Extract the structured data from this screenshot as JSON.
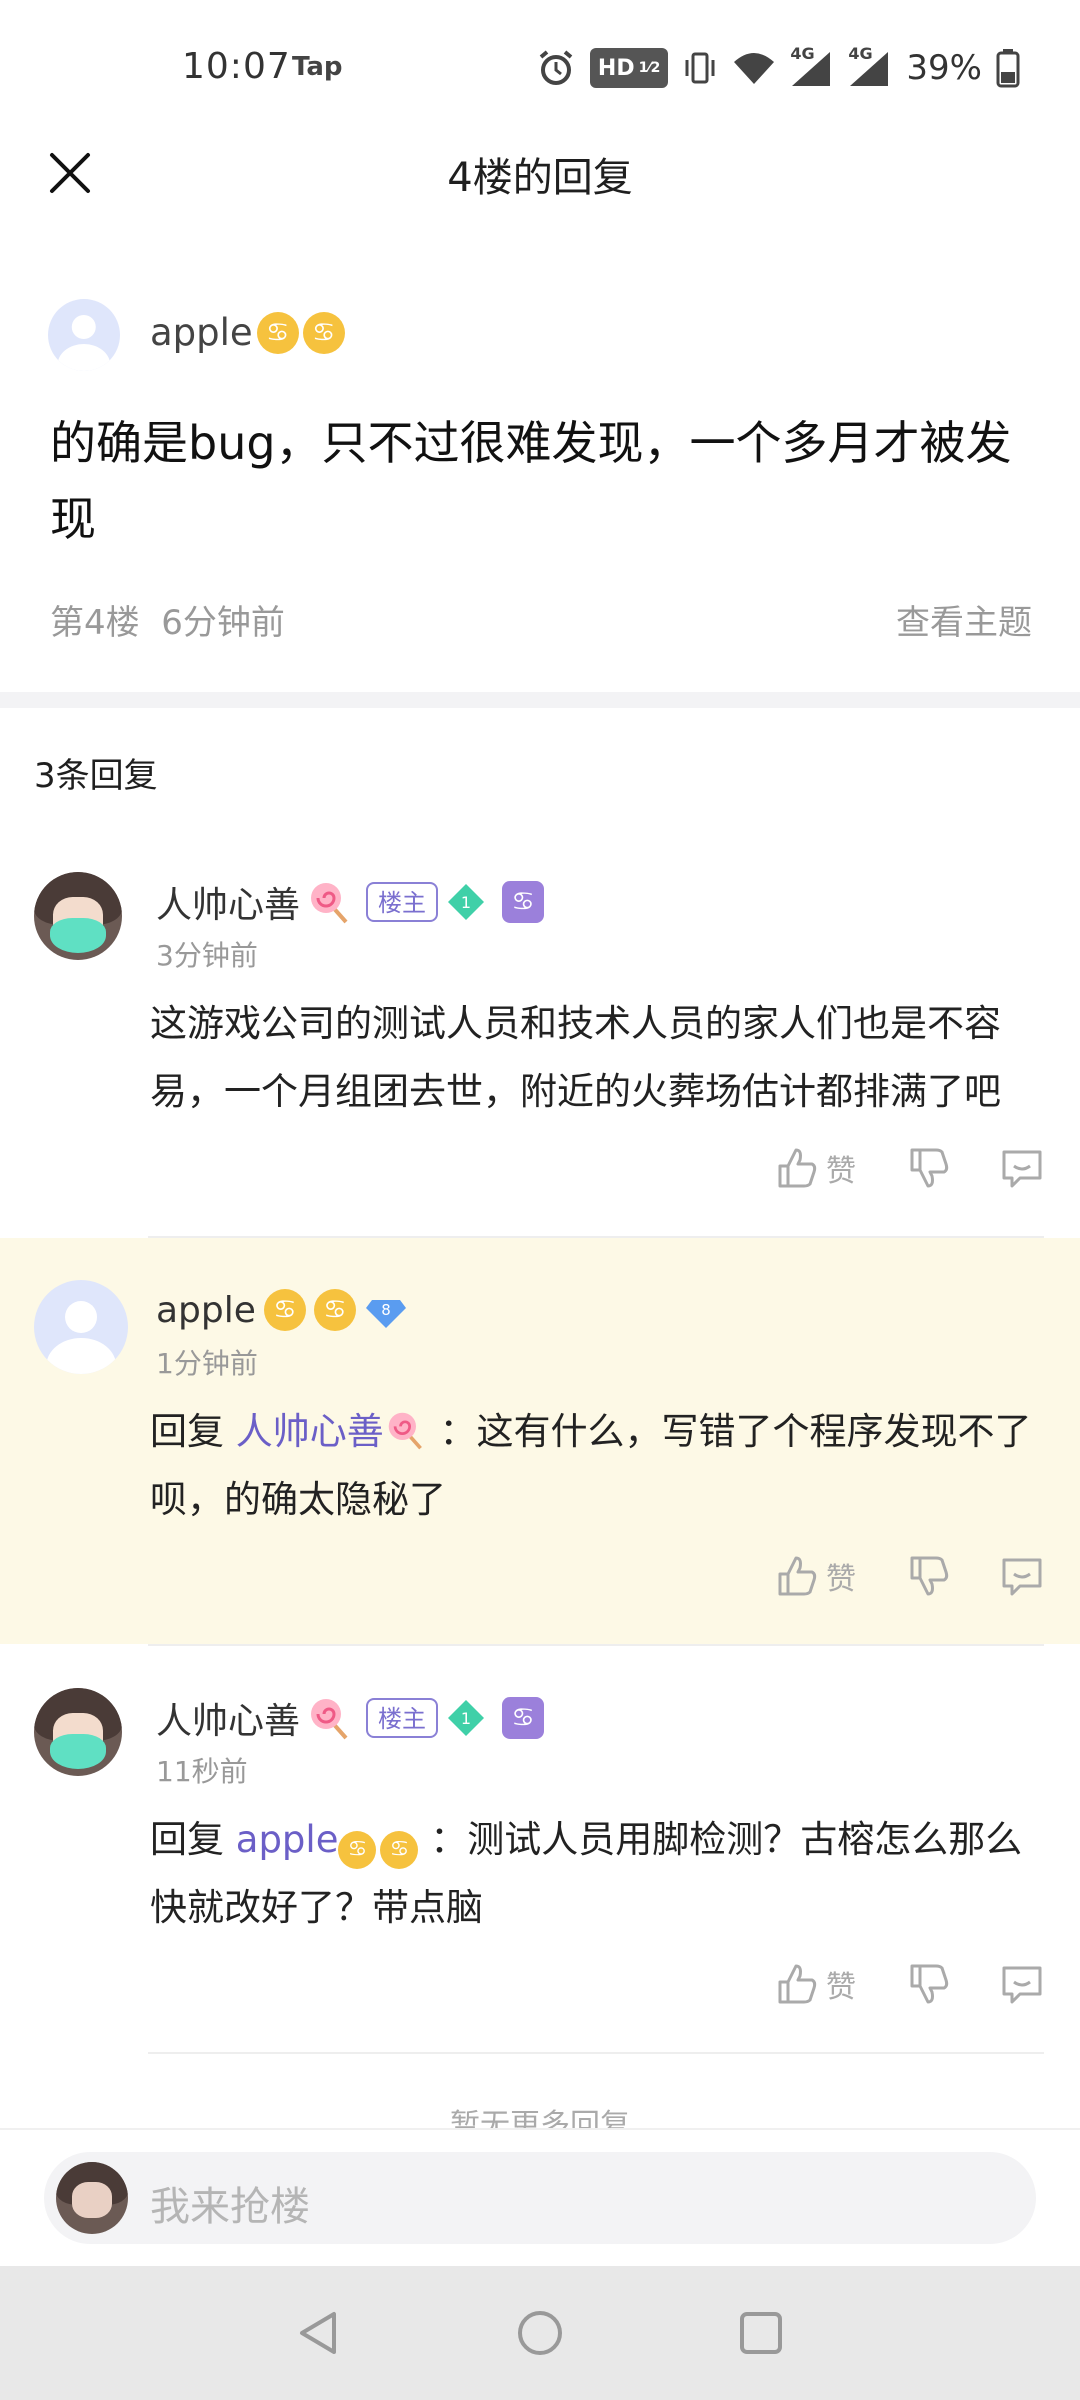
{
  "status_bar": {
    "time": "10:07",
    "app_indicator": "Tap",
    "hd_label": "HD",
    "network_1": "4G",
    "network_2": "4G",
    "battery": "39%"
  },
  "header": {
    "title": "4楼的回复",
    "close_icon": "close-icon"
  },
  "main_post": {
    "username": "apple",
    "content": "的确是bug，只不过很难发现，一个多月才被发现",
    "floor": "第4楼",
    "time": "6分钟前",
    "view_topic": "查看主题"
  },
  "reply_count": "3条回复",
  "replies": [
    {
      "username": "人帅心善",
      "badge": "楼主",
      "gem_level": "1",
      "time": "3分钟前",
      "text": "这游戏公司的测试人员和技术人员的家人们也是不容易，一个月组团去世，附近的火葬场估计都排满了吧",
      "like_label": "赞"
    },
    {
      "username": "apple",
      "gem_level": "8",
      "time": "1分钟前",
      "reply_prefix": "回复",
      "mention": "人帅心善",
      "text": "：这有什么，写错了个程序发现不了呗，的确太隐秘了",
      "like_label": "赞"
    },
    {
      "username": "人帅心善",
      "badge": "楼主",
      "gem_level": "1",
      "time": "11秒前",
      "reply_prefix": "回复",
      "mention": "apple",
      "text": "：测试人员用脚检测？古榕怎么那么快就改好了？带点脑",
      "like_label": "赞"
    }
  ],
  "no_more": "暂无更多回复",
  "input": {
    "placeholder": "我来抢楼"
  },
  "colors": {
    "accent": "#6b5fc7",
    "highlight_bg": "#fdf9e6",
    "zodiac": "#f6c23e"
  }
}
